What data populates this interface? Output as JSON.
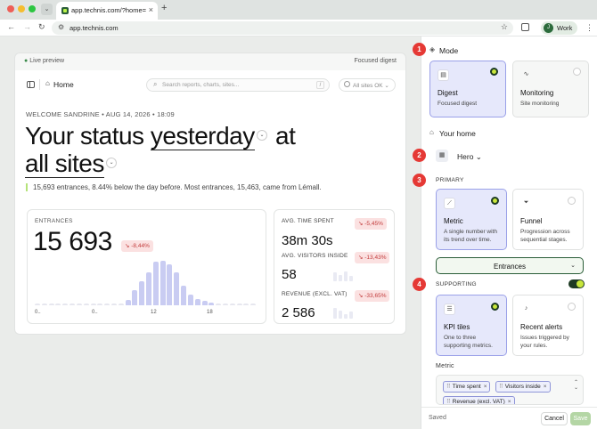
{
  "browser": {
    "tab_title": "app.technis.com/?home=home",
    "url": "app.technis.com",
    "profile_initial": "J",
    "profile_label": "Work",
    "new_tab": "+",
    "tab_close": "×"
  },
  "preview": {
    "live_label": "Live preview",
    "focus_label": "Focused digest",
    "home_label": "Home",
    "search_placeholder": "Search reports, charts, sites...",
    "search_key": "/",
    "sites_status": "All sites OK",
    "welcome": "WELCOME SANDRINE • AUG 14, 2026 • 18:09",
    "headline": {
      "part1": "Your status",
      "period": "yesterday",
      "part2": "at",
      "scope": "all sites"
    },
    "summary": "15,693 entrances, 8.44% below the day before. Most entrances, 15,463, came from Lémall.",
    "main_kpi": {
      "label": "ENTRANCES",
      "value": "15 693",
      "delta": "-8,44%",
      "axis_labels": [
        "0..",
        "0..",
        "12",
        "18"
      ],
      "hourly": [
        0,
        0,
        0,
        0,
        0,
        0,
        0,
        0,
        0,
        0,
        0,
        0,
        0,
        5,
        14,
        22,
        30,
        40,
        41,
        38,
        30,
        18,
        10,
        6,
        4,
        2,
        0,
        0,
        0,
        0,
        0,
        0
      ],
      "color_active": "#c9ccf2",
      "color_empty": "#e6e7ef"
    },
    "side_kpis": [
      {
        "label": "AVG. TIME SPENT",
        "value": "38m 30s",
        "delta": "-5,45%"
      },
      {
        "label": "AVG. VISITORS INSIDE",
        "value": "58",
        "delta": "-13,43%"
      },
      {
        "label": "REVENUE (EXCL. VAT)",
        "value": "2 586",
        "delta": "-33,65%"
      }
    ]
  },
  "panel": {
    "callouts": [
      "1",
      "2",
      "3",
      "4"
    ],
    "mode_title": "Mode",
    "mode_options": [
      {
        "title": "Digest",
        "desc": "Focused digest",
        "selected": true
      },
      {
        "title": "Monitoring",
        "desc": "Site monitoring",
        "selected": false
      }
    ],
    "home_title": "Your home",
    "hero_label": "Hero",
    "primary_label": "PRIMARY",
    "primary_options": [
      {
        "title": "Metric",
        "desc": "A single number with its trend over time.",
        "selected": true
      },
      {
        "title": "Funnel",
        "desc": "Progression across sequential stages.",
        "selected": false
      }
    ],
    "metric_select": "Entrances",
    "supporting_label": "SUPPORTING",
    "supporting_enabled": true,
    "supporting_options": [
      {
        "title": "KPI tiles",
        "desc": "One to three supporting metrics.",
        "selected": true
      },
      {
        "title": "Recent alerts",
        "desc": "Issues triggered by your rules.",
        "selected": false
      }
    ],
    "metric_label": "Metric",
    "chips": [
      "Time spent",
      "Visitors inside",
      "Revenue (excl. VAT)"
    ],
    "saved": "Saved",
    "cancel": "Cancel",
    "save": "Save",
    "accent": "#c8e63c",
    "callout_color": "#e53935"
  }
}
